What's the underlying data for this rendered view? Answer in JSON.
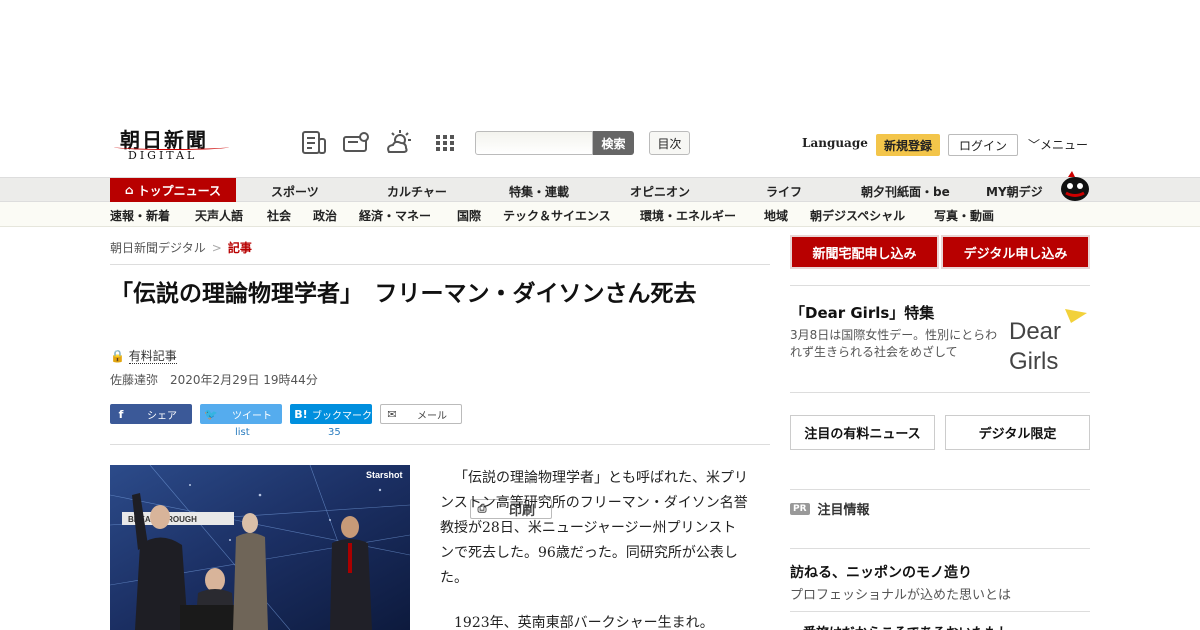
{
  "header": {
    "logo_jp": "朝日新聞",
    "logo_en": "DIGITAL",
    "search_placeholder": "",
    "search_button": "検索",
    "toc_button": "目次",
    "language": "Language",
    "register": "新規登録",
    "login": "ログイン",
    "menu": "メニュー"
  },
  "nav_main": {
    "home": "トップニュース",
    "items": [
      "スポーツ",
      "カルチャー",
      "特集・連載",
      "オピニオン",
      "ライフ",
      "朝夕刊紙面・be",
      "MY朝デジ"
    ]
  },
  "nav_sub": {
    "items": [
      "速報・新着",
      "天声人語",
      "社会",
      "政治",
      "経済・マネー",
      "国際",
      "テック＆サイエンス",
      "環境・エネルギー",
      "地域",
      "朝デジスペシャル",
      "写真・動画"
    ]
  },
  "breadcrumb": {
    "root": "朝日新聞デジタル",
    "sep": ">",
    "current": "記事"
  },
  "article": {
    "title": "「伝説の理論物理学者」　フリーマン・ダイソンさん死去",
    "paid_label": "有料記事",
    "author": "佐藤達弥",
    "date": "2020年2月29日 19時44分",
    "photo_overlay": [
      "Starshot",
      "BREAKTHROUGH"
    ],
    "paragraphs": [
      "「伝説の理論物理学者」とも呼ばれた、米プリンストン高等研究所のフリーマン・ダイソン名誉教授が28日、米ニュージャージー州プリンストンで死去した。96歳だった。同研究所が公表した。",
      "1923年、英南東部バークシャー生まれ。"
    ]
  },
  "share": {
    "facebook": "シェア",
    "twitter": "ツイート",
    "hatena_icon": "B!",
    "hatena": "ブックマーク",
    "mail": "メール",
    "print": "印刷",
    "twitter_count": "list",
    "hatena_count": "35"
  },
  "sidebar": {
    "newspaper_btn": "新聞宅配申し込み",
    "digital_btn": "デジタル申し込み",
    "feature_title": "「Dear Girls」特集",
    "feature_text": "3月8日は国際女性デー。性別にとらわれず生きられる社会をめざして",
    "feature_logo": [
      "Dear",
      "Girls"
    ],
    "paid_news_btn": "注目の有料ニュース",
    "digital_only_btn": "デジタル限定",
    "pr_tag": "PR",
    "pr_label": "注目情報",
    "promo_title": "訪ねる、ニッポンのモノ造り",
    "promo_sub": "プロフェッショナルが込めた思いとは",
    "promo_cut": "一番旅はだからこそであるおいたもし"
  }
}
